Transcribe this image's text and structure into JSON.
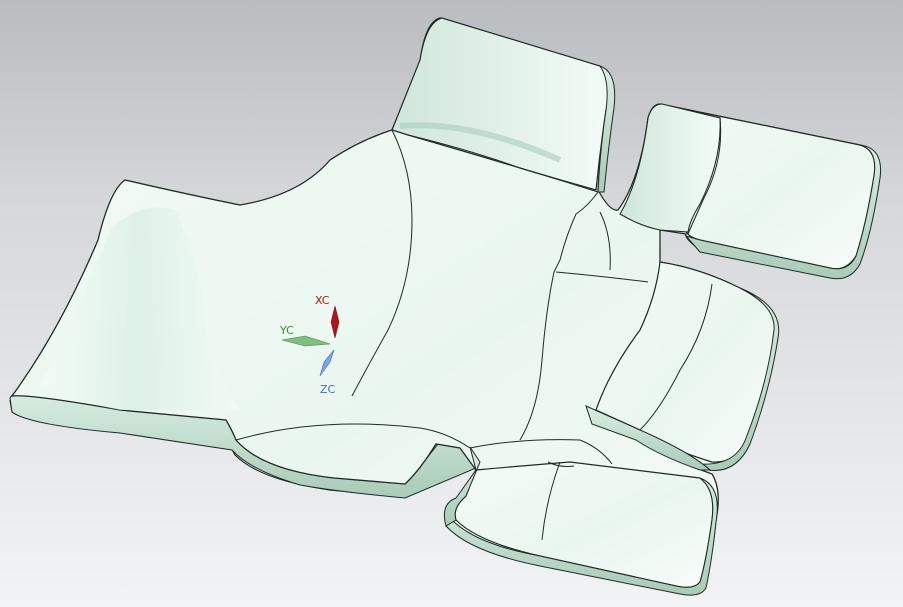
{
  "viewport": {
    "background_top": "#b9bcbf",
    "background_bottom": "#f2f3f4",
    "model_fill": "#eef8f2",
    "model_edge": "#1f2a26",
    "model_shade": "#bfe0cf"
  },
  "triad": {
    "x_label": "XC",
    "y_label": "YC",
    "z_label": "ZC",
    "x_color": "#b0141c",
    "y_color": "#3f8a3f",
    "z_color": "#3f6fd1",
    "x_icon": "arrow-icon",
    "y_icon": "arrow-icon",
    "z_icon": "arrow-icon"
  }
}
